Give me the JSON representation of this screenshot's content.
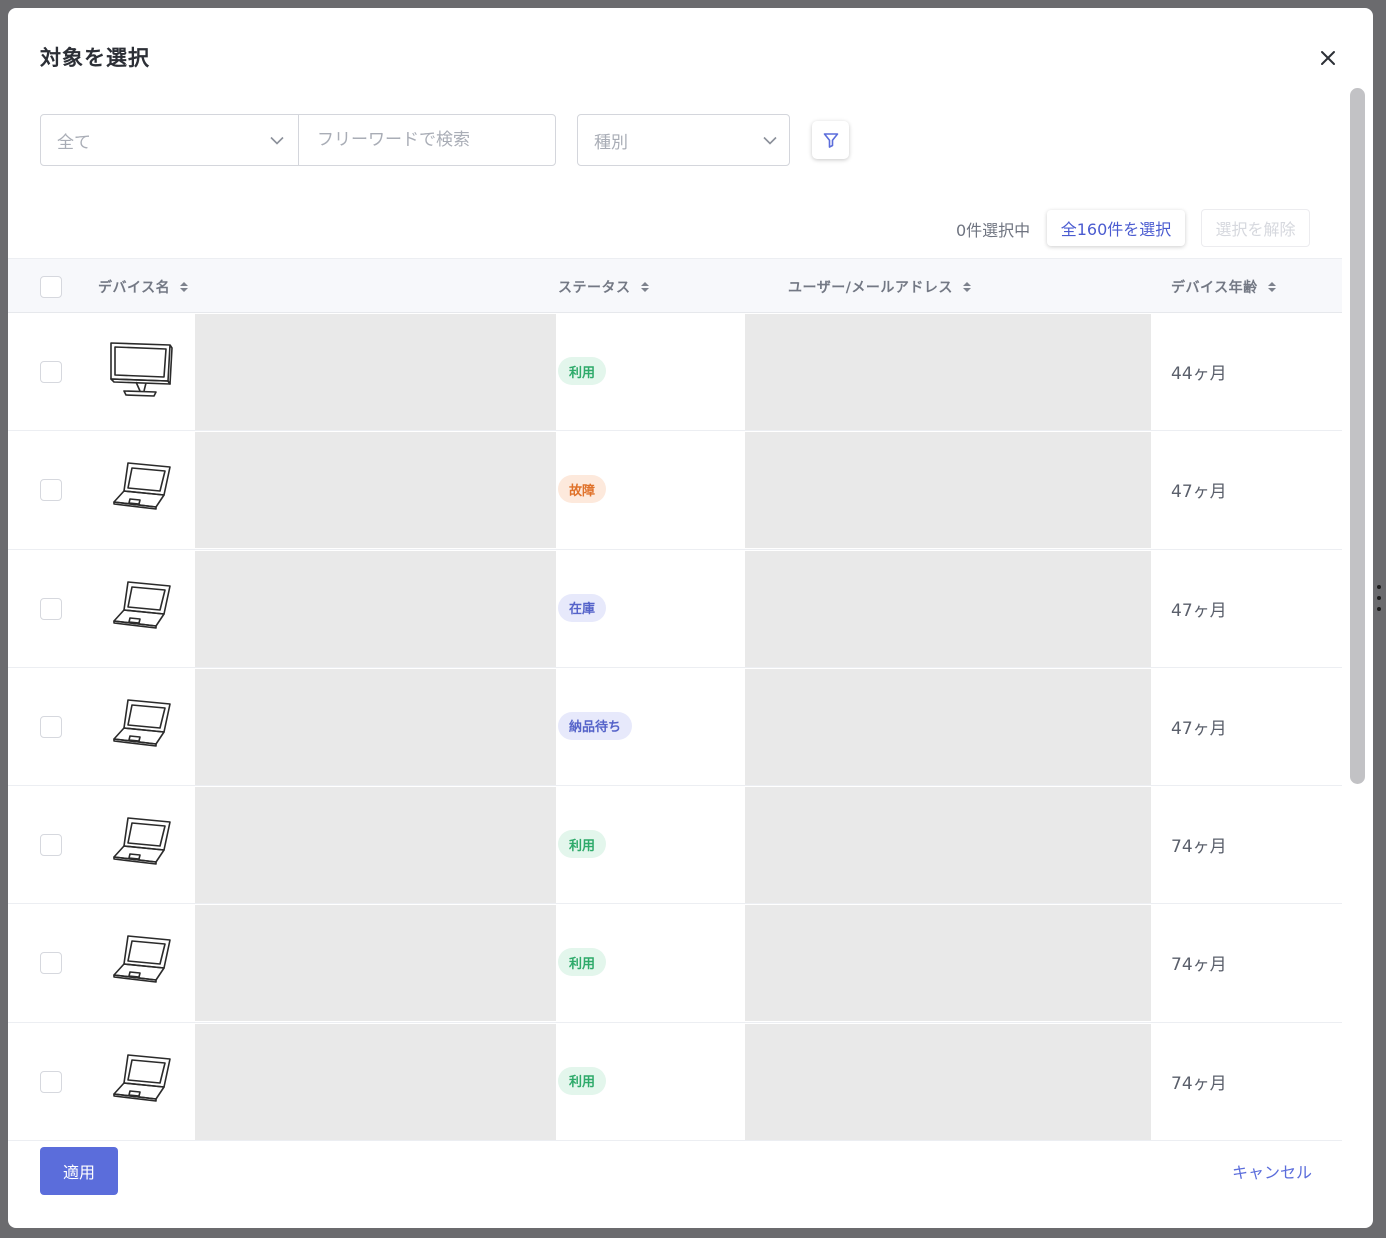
{
  "modal": {
    "title": "対象を選択",
    "close_icon": "close-icon"
  },
  "filters": {
    "scope_select_value": "全て",
    "search_placeholder": "フリーワードで検索",
    "type_select_placeholder": "種別",
    "filter_icon": "filter-icon"
  },
  "selection": {
    "count_text": "0件選択中",
    "select_all_label": "全160件を選択",
    "deselect_label": "選択を解除"
  },
  "table": {
    "columns": [
      "デバイス名",
      "ステータス",
      "ユーザー/メールアドレス",
      "デバイス年齢"
    ],
    "rows": [
      {
        "device_type": "desktop",
        "status": "利用",
        "status_color": "#2eaa6a",
        "status_bg": "#e3f6ec",
        "age": "44ヶ月"
      },
      {
        "device_type": "laptop",
        "status": "故障",
        "status_color": "#e0722b",
        "status_bg": "#fde9dc",
        "age": "47ヶ月"
      },
      {
        "device_type": "laptop",
        "status": "在庫",
        "status_color": "#5563c9",
        "status_bg": "#e7e9fb",
        "age": "47ヶ月"
      },
      {
        "device_type": "laptop",
        "status": "納品待ち",
        "status_color": "#5563c9",
        "status_bg": "#e7e9fb",
        "age": "47ヶ月"
      },
      {
        "device_type": "laptop",
        "status": "利用",
        "status_color": "#2eaa6a",
        "status_bg": "#e3f6ec",
        "age": "74ヶ月"
      },
      {
        "device_type": "laptop",
        "status": "利用",
        "status_color": "#2eaa6a",
        "status_bg": "#e3f6ec",
        "age": "74ヶ月"
      },
      {
        "device_type": "laptop",
        "status": "利用",
        "status_color": "#2eaa6a",
        "status_bg": "#e3f6ec",
        "age": "74ヶ月"
      }
    ]
  },
  "footer": {
    "apply_label": "適用",
    "cancel_label": "キャンセル"
  },
  "colors": {
    "accent": "#5b6ddb"
  }
}
